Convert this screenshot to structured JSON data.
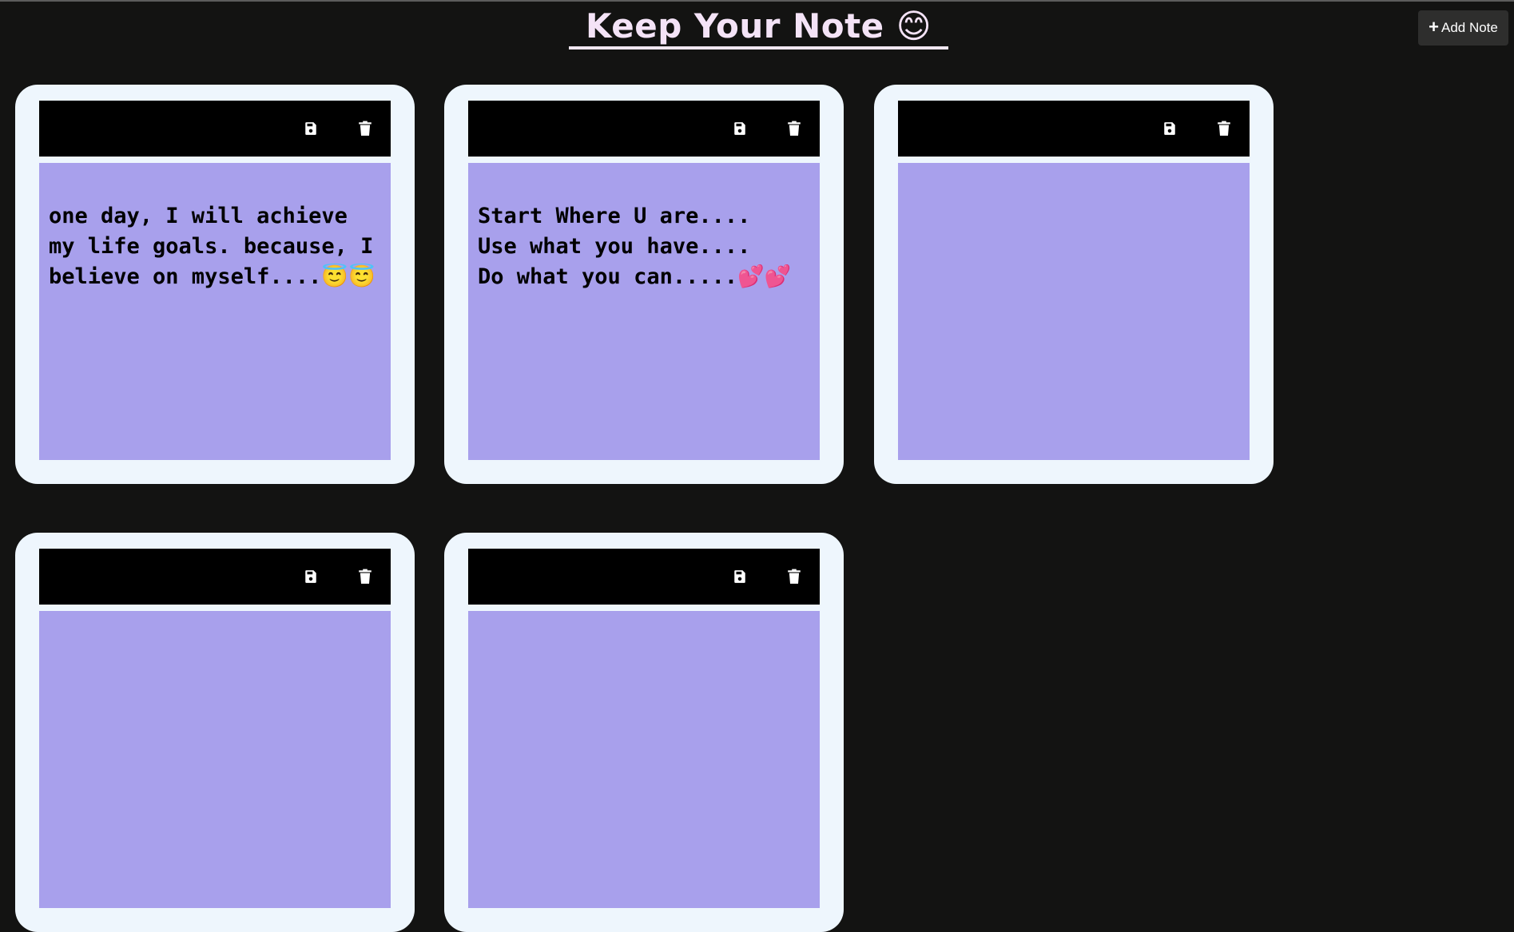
{
  "header": {
    "title": "Keep Your Note 😊",
    "add_note_label": "Add Note",
    "add_note_icon": "plus-icon"
  },
  "colors": {
    "background": "#131312",
    "card": "#eef6fd",
    "toolbar": "#000000",
    "note_body": "#a8a0ec",
    "title": "#f4e3f7"
  },
  "notes": [
    {
      "text": "one day, I will achieve my life goals. because, I believe on myself....😇😇",
      "save_icon": "floppy-disk-icon",
      "delete_icon": "trash-icon"
    },
    {
      "text": "Start Where U are....\nUse what you have....\nDo what you can.....💕💕",
      "save_icon": "floppy-disk-icon",
      "delete_icon": "trash-icon"
    },
    {
      "text": "",
      "save_icon": "floppy-disk-icon",
      "delete_icon": "trash-icon"
    },
    {
      "text": "",
      "save_icon": "floppy-disk-icon",
      "delete_icon": "trash-icon"
    },
    {
      "text": "",
      "save_icon": "floppy-disk-icon",
      "delete_icon": "trash-icon"
    }
  ]
}
